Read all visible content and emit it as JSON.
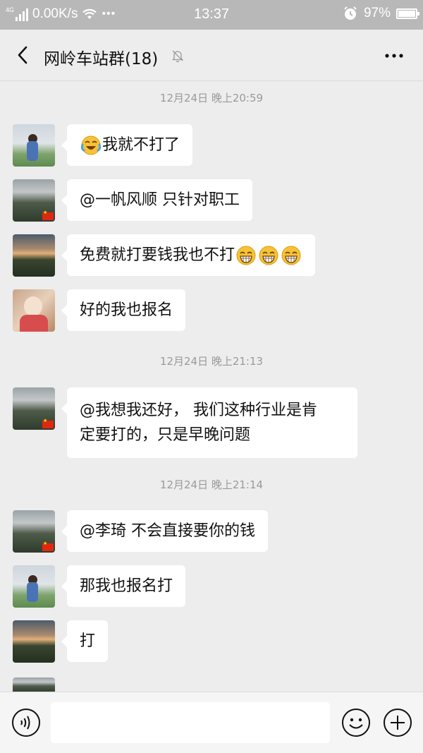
{
  "status_bar": {
    "network_type": "4G",
    "speed": "0.00K/s",
    "dots": "•••",
    "time": "13:37",
    "battery_percent": "97%",
    "battery_level": 0.97
  },
  "header": {
    "title": "网岭车站群(18)"
  },
  "timestamps": [
    "12月24日 晚上20:59",
    "12月24日 晚上21:13",
    "12月24日 晚上21:14"
  ],
  "messages": [
    {
      "avatar": "boy-on-grass",
      "text": "我就不打了",
      "emoji_before": "laughing-tears-emoji"
    },
    {
      "avatar": "mountain-landscape",
      "text": "@一帆风顺  只针对职工"
    },
    {
      "avatar": "sunset-landscape",
      "text": "免费就打要钱我也不打",
      "emoji_after": "grinning-emoji x3"
    },
    {
      "avatar": "baby-girl",
      "text": "好的我也报名"
    },
    {
      "avatar": "mountain-landscape",
      "text_line1": "@我想我还好，  我们这种行业是肯",
      "text_line2": "定要打的，只是早晚问题"
    },
    {
      "avatar": "mountain-landscape",
      "text": "@李琦  不会直接要你的钱"
    },
    {
      "avatar": "boy-on-grass",
      "text": "那我也报名打"
    },
    {
      "avatar": "sunset-landscape",
      "text": "打"
    }
  ],
  "colors": {
    "background": "#ededed",
    "bubble": "#ffffff",
    "timestamp": "#9a9a9a",
    "status_bar": "#b8b8b8"
  }
}
